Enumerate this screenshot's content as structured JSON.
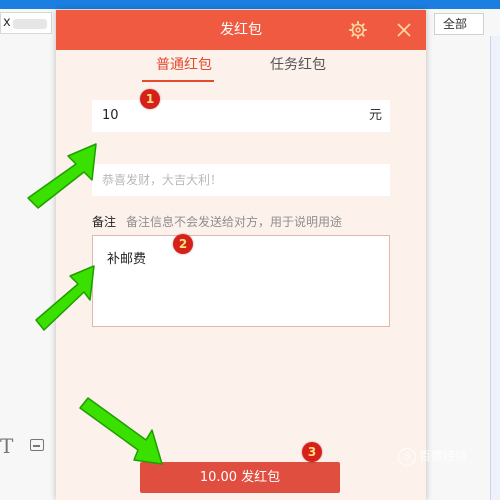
{
  "background": {
    "left_text": "x",
    "right_button_label": "全部"
  },
  "dialog": {
    "title": "发红包",
    "tabs": [
      {
        "label": "普通红包",
        "active": true
      },
      {
        "label": "任务红包",
        "active": false
      }
    ],
    "amount": {
      "value": "10",
      "unit": "元"
    },
    "greeting": {
      "placeholder": "恭喜发财，大吉大利！"
    },
    "remark": {
      "label": "备注",
      "hint": "备注信息不会发送给对方，用于说明用途",
      "value": "补邮费"
    },
    "send_button_label": "10.00 发红包"
  },
  "annotations": {
    "step_1": "1",
    "step_2": "2",
    "step_3": "3"
  },
  "watermark": {
    "circle": "S",
    "text": "百度经验"
  },
  "colors": {
    "header": "#f05a40",
    "accent": "#e24b2e",
    "dialog_bg": "#fdf1ec",
    "button": "#e04e3f",
    "badge": "#d8201b",
    "arrow": "#39e000"
  }
}
